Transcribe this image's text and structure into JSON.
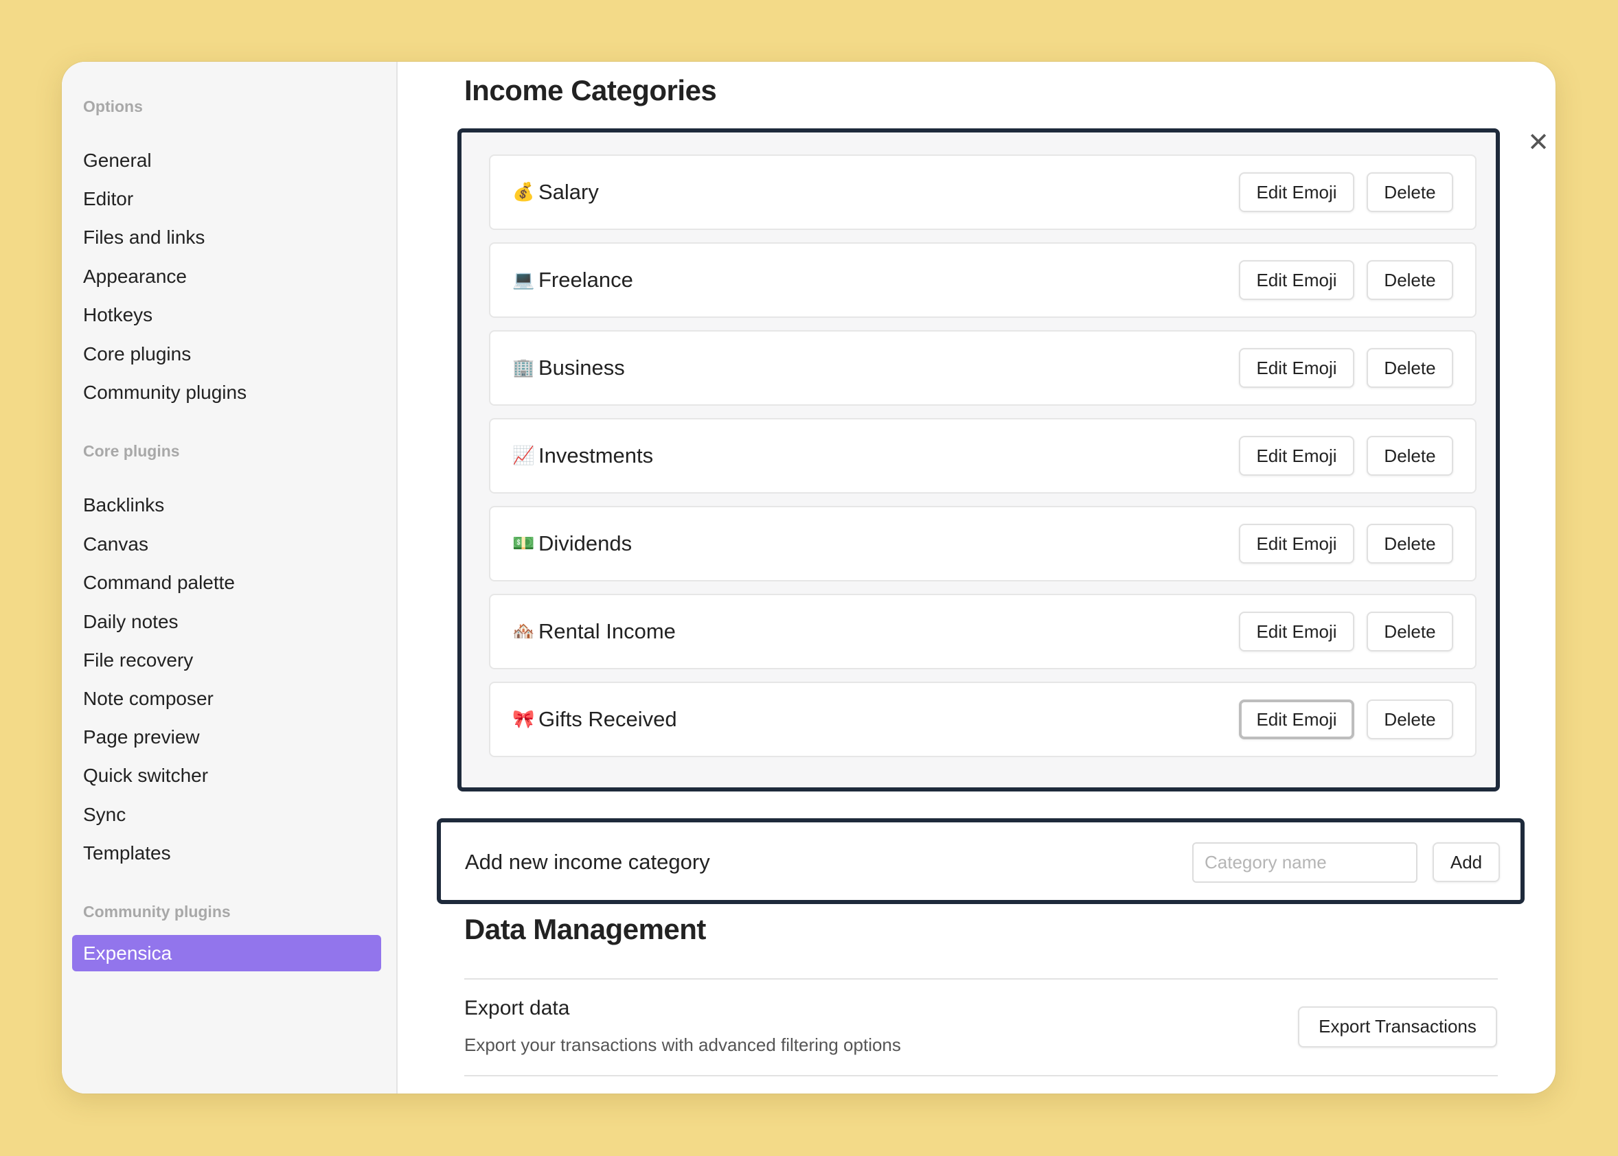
{
  "sidebar": {
    "sections": [
      {
        "heading": "Options",
        "items": [
          "General",
          "Editor",
          "Files and links",
          "Appearance",
          "Hotkeys",
          "Core plugins",
          "Community plugins"
        ]
      },
      {
        "heading": "Core plugins",
        "items": [
          "Backlinks",
          "Canvas",
          "Command palette",
          "Daily notes",
          "File recovery",
          "Note composer",
          "Page preview",
          "Quick switcher",
          "Sync",
          "Templates"
        ]
      },
      {
        "heading": "Community plugins",
        "items": [
          "Expensica"
        ]
      }
    ],
    "active_item": "Expensica",
    "active_color": "#9275ec"
  },
  "income": {
    "title": "Income Categories",
    "categories": [
      {
        "emoji": "💰",
        "name": "Salary"
      },
      {
        "emoji": "💻",
        "name": "Freelance"
      },
      {
        "emoji": "🏢",
        "name": "Business"
      },
      {
        "emoji": "📈",
        "name": "Investments"
      },
      {
        "emoji": "💵",
        "name": "Dividends"
      },
      {
        "emoji": "🏘️",
        "name": "Rental Income"
      },
      {
        "emoji": "🎀",
        "name": "Gifts Received"
      }
    ],
    "edit_label": "Edit Emoji",
    "delete_label": "Delete"
  },
  "add_category": {
    "label": "Add new income category",
    "placeholder": "Category name",
    "button": "Add"
  },
  "data_management": {
    "title": "Data Management",
    "export_title": "Export data",
    "export_desc": "Export your transactions with advanced filtering options",
    "export_button": "Export Transactions"
  },
  "close_icon": "close-icon",
  "highlight_color": "#1e2a3b",
  "background_color": "#f3da88"
}
